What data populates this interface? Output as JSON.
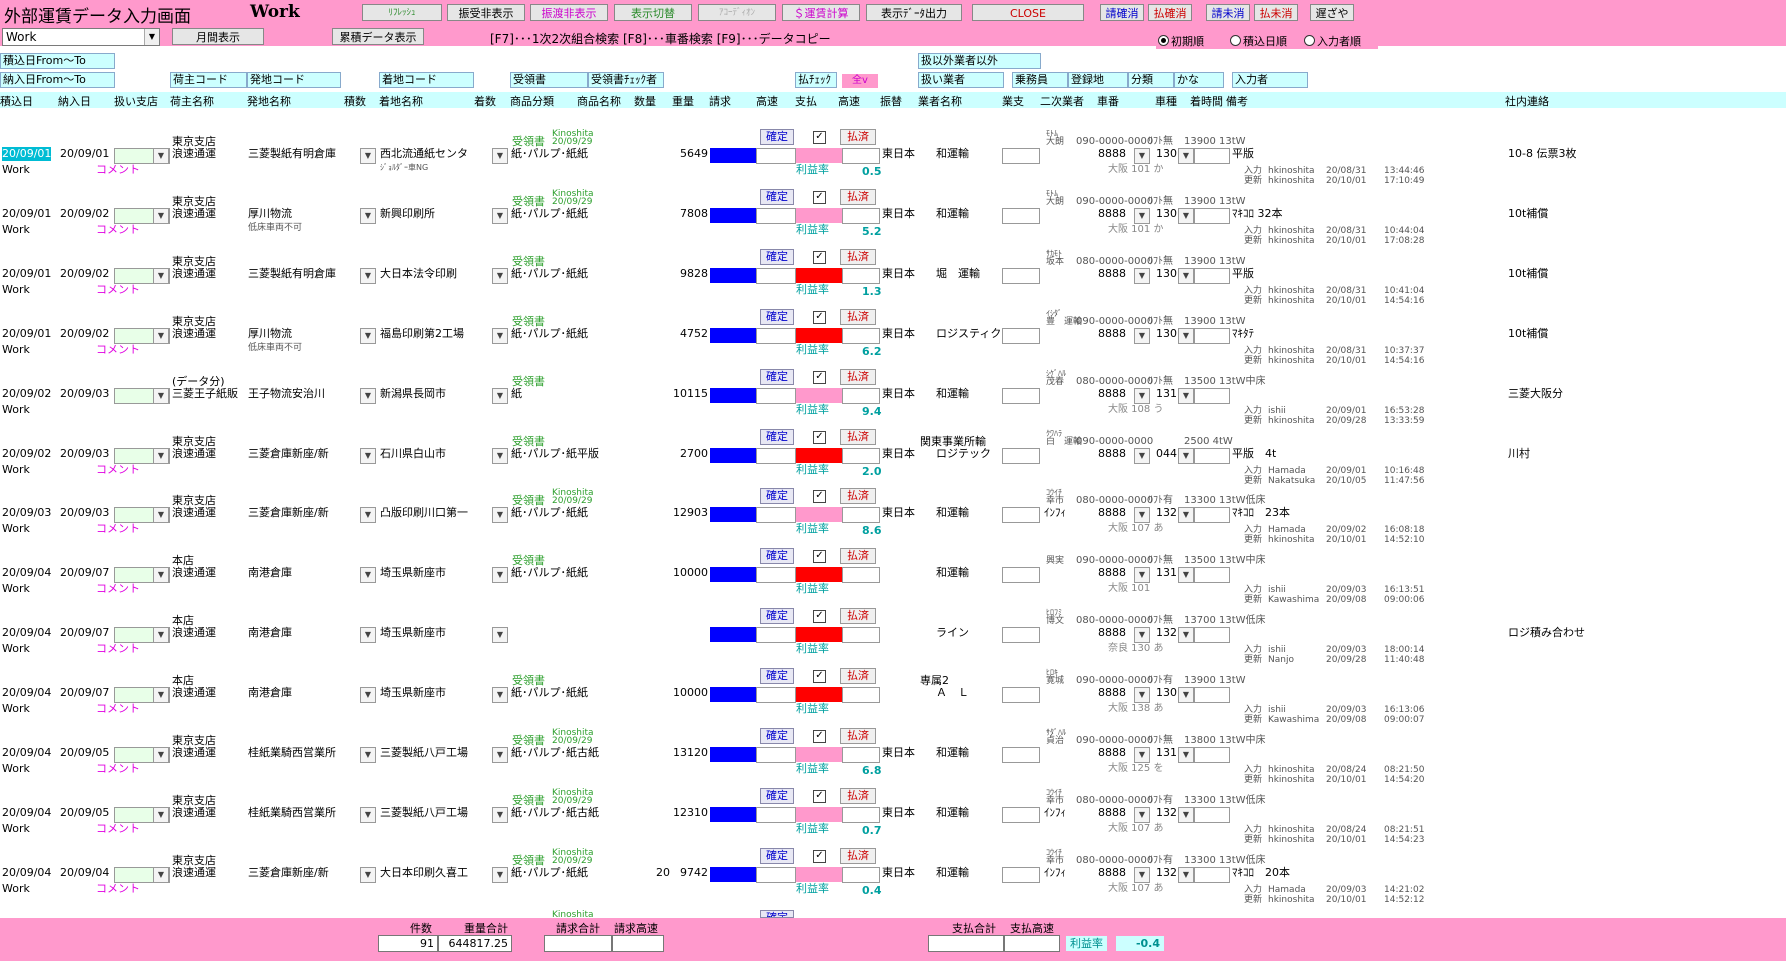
{
  "header": {
    "title": "外部運賃データ入力画面",
    "mode": "Work",
    "buttons": {
      "refresh": "ﾘﾌﾚｯｼｭ",
      "recv_hide": "振受非表示",
      "deliv_hide": "振渡非表示",
      "toggle": "表示切替",
      "accord": "ｱｺｰﾃﾞｨｵﾝ",
      "calc": "＄運賃計算",
      "export": "表示ﾃﾞｰﾀ出力",
      "close": "CLOSE",
      "confirm_clear": "請確消",
      "pay_confirm": "払確消",
      "bill_clear": "請未消",
      "pay_clear": "払未消",
      "delay": "遅ざや"
    },
    "mode_select": "Work",
    "monthly": "月間表示",
    "cumulative": "累積データ表示",
    "fkeys": "[F7]･･･1次2次組合検索  [F8]･･･車番検索  [F9]･･･データコピー",
    "sort": {
      "initial": "初期順",
      "load_date": "積込日順",
      "input_user": "入力者順"
    }
  },
  "filters": {
    "load_from_to": "積込日From〜To",
    "deliv_from_to": "納入日From〜To",
    "other_vendor": "扱以外業者以外",
    "shipper_code": "荷主コード",
    "origin_code": "発地コード",
    "dest_code": "着地コード",
    "receipt": "受領書",
    "receipt_check": "受領書ﾁｪｯｸ者",
    "pay_check": "払ﾁｪｯｸ",
    "all_v": "全v",
    "handler": "扱い業者",
    "crew": "乗務員",
    "reg_place": "登録地",
    "class": "分類",
    "kana": "かな",
    "input_user": "入力者"
  },
  "columns": [
    "積込日",
    "納入日",
    "扱い支店",
    "荷主名称",
    "発地名称",
    "積数",
    "着地名称",
    "着数",
    "商品分類",
    "商品名称",
    "数量",
    "重量",
    "請求",
    "高速",
    "支払",
    "高速",
    "振替",
    "業者名称",
    "業支",
    "二次業者",
    "車番",
    "車種",
    "着時間",
    "備考",
    "社内連絡"
  ],
  "rows": [
    {
      "branch_top": "東京支店",
      "load": "20/09/01",
      "deliv": "20/09/01",
      "shipper": "浪速通運",
      "origin": "三菱製紙有明倉庫",
      "dest": "西北流通紙センタ",
      "dest_note": "ｼﾞｮﾙﾀﾞｰ車NG",
      "receipt": "受領書",
      "kino": "Kinoshita",
      "kdate": "20/09/29",
      "category": "紙･パルプ･紙紙",
      "qty": "",
      "weight": "5649",
      "pay_color": "pink",
      "rate": "0.5",
      "org": "東日本",
      "vendor": "和運輸",
      "sub_kana": "ﾓﾄﾑ",
      "sub": "大朗",
      "phone": "090-0000-0000",
      "lift": "ﾘﾌﾄ無",
      "car": "8888",
      "cartype": "130",
      "place": "大阪 101 か",
      "note_top": "13900 13tW",
      "note": "平版",
      "in_user": "hkinoshita",
      "in_date": "20/08/31",
      "in_time": "13:44:46",
      "up_user": "hkinoshita",
      "up_date": "20/10/01",
      "up_time": "17:10:49",
      "memo": "10-8 伝票3枚",
      "work": "Work",
      "comment": "コメント"
    },
    {
      "branch_top": "東京支店",
      "load": "20/09/01",
      "deliv": "20/09/02",
      "shipper": "浪速通運",
      "origin": "厚川物流",
      "origin_note": "低床車両不可",
      "dest": "新興印刷所",
      "dest_note": "",
      "receipt": "受領書",
      "kino": "Kinoshita",
      "kdate": "20/09/29",
      "category": "紙･パルプ･紙紙",
      "qty": "",
      "weight": "7808",
      "pay_color": "pink",
      "rate": "5.2",
      "org": "東日本",
      "vendor": "和運輸",
      "sub_kana": "ﾓﾄﾑ",
      "sub": "大朗",
      "phone": "090-0000-0000",
      "lift": "ﾘﾌﾄ無",
      "car": "8888",
      "cartype": "130",
      "place": "大阪 101 か",
      "note_top": "13900 13tW",
      "note": "ﾏｷｺﾛ 32本",
      "in_user": "hkinoshita",
      "in_date": "20/08/31",
      "in_time": "10:44:04",
      "up_user": "hkinoshita",
      "up_date": "20/10/01",
      "up_time": "17:08:28",
      "memo": "10t補償",
      "work": "Work",
      "comment": "コメント"
    },
    {
      "branch_top": "東京支店",
      "load": "20/09/01",
      "deliv": "20/09/02",
      "shipper": "浪速通運",
      "origin": "三菱製紙有明倉庫",
      "dest": "大日本法令印刷",
      "dest_note": "",
      "receipt": "受領書",
      "kino": "",
      "kdate": "",
      "category": "紙･パルプ･紙紙",
      "qty": "",
      "weight": "9828",
      "pay_color": "red",
      "rate": "1.3",
      "org": "東日本",
      "vendor": "堀　運輸",
      "sub_kana": "ｻｶﾓﾄ",
      "sub": "坂本",
      "phone": "080-0000-0000",
      "lift": "ﾘﾌﾄ無",
      "car": "8888",
      "cartype": "130",
      "place": "",
      "note_top": "13900 13tW",
      "note": "平版",
      "in_user": "hkinoshita",
      "in_date": "20/08/31",
      "in_time": "10:41:04",
      "up_user": "hkinoshita",
      "up_date": "20/10/01",
      "up_time": "14:54:16",
      "memo": "10t補償",
      "work": "Work",
      "comment": "コメント"
    },
    {
      "branch_top": "東京支店",
      "load": "20/09/01",
      "deliv": "20/09/02",
      "shipper": "浪速通運",
      "origin": "厚川物流",
      "origin_note": "低床車両不可",
      "dest": "福島印刷第2工場",
      "dest_note": "",
      "receipt": "受領書",
      "kino": "",
      "kdate": "",
      "category": "紙･パルプ･紙紙",
      "qty": "",
      "weight": "4752",
      "pay_color": "red",
      "rate": "6.2",
      "org": "東日本",
      "vendor": "ロジスティクス",
      "sub_kana": "ｲｼﾀﾞ",
      "sub": "豊　運輸",
      "phone": "090-0000-0000",
      "lift": "ﾘﾌﾄ無",
      "car": "8888",
      "cartype": "130",
      "place": "",
      "note_top": "13900 13tW",
      "note": "ﾏｷﾀﾃ",
      "in_user": "hkinoshita",
      "in_date": "20/08/31",
      "in_time": "10:37:37",
      "up_user": "hkinoshita",
      "up_date": "20/10/01",
      "up_time": "14:54:16",
      "memo": "10t補償",
      "work": "Work",
      "comment": "コメント"
    },
    {
      "branch_top": "(データ分)",
      "load": "20/09/02",
      "deliv": "20/09/03",
      "shipper": "三菱王子紙販",
      "origin": "王子物流安治川",
      "dest": "新潟県長岡市",
      "dest_note": "",
      "receipt": "受領書",
      "kino": "",
      "kdate": "",
      "category": "紙",
      "qty": "",
      "weight": "10115",
      "pay_color": "pink",
      "rate": "9.4",
      "org": "東日本",
      "vendor": "和運輸",
      "sub_kana": "ｼｹﾞﾊﾙ",
      "sub": "茂春",
      "phone": "080-0000-0000",
      "lift": "ﾘﾌﾄ無",
      "car": "8888",
      "cartype": "131",
      "place": "大阪 108 う",
      "note_top": "13500 13tW中床",
      "note": "",
      "in_user": "ishii",
      "in_date": "20/09/01",
      "in_time": "16:53:28",
      "up_user": "hkinoshita",
      "up_date": "20/09/28",
      "up_time": "13:33:59",
      "memo": "三菱大阪分",
      "work": "Work",
      "comment": ""
    },
    {
      "branch_top": "東京支店",
      "load": "20/09/02",
      "deliv": "20/09/03",
      "shipper": "浪速通運",
      "origin": "三菱倉庫新座/新",
      "dest": "石川県白山市",
      "dest_note": "",
      "receipt": "受領書",
      "kino": "",
      "kdate": "",
      "category": "紙･パルプ･紙平版",
      "qty": "",
      "weight": "2700",
      "pay_color": "red",
      "rate": "2.0",
      "org": "東日本",
      "vendor": "ロジテック",
      "vendor_top": "関東事業所輸",
      "sub_kana": "ｸﾜﾊﾗ",
      "sub": "白　運輸",
      "phone": "090-0000-0000",
      "lift": "",
      "car": "8888",
      "cartype": "044",
      "place": "",
      "note_top": "2500 4tW",
      "note": "平版　4t",
      "in_user": "Hamada",
      "in_date": "20/09/01",
      "in_time": "10:16:48",
      "up_user": "Nakatsuka",
      "up_date": "20/10/05",
      "up_time": "11:47:56",
      "memo": "川村",
      "work": "Work",
      "comment": "コメント"
    },
    {
      "branch_top": "東京支店",
      "load": "20/09/03",
      "deliv": "20/09/03",
      "shipper": "浪速通運",
      "origin": "三菱倉庫新座/新",
      "dest": "凸版印刷川口第一",
      "dest_note": "",
      "receipt": "受領書",
      "kino": "Kinoshita",
      "kdate": "20/09/29",
      "category": "紙･パルプ･紙紙",
      "qty": "",
      "weight": "12903",
      "pay_color": "pink",
      "rate": "8.6",
      "org": "東日本",
      "vendor": "和運輸",
      "sub_kana": "ｺｳｲﾁ",
      "sub": "幸市",
      "phone": "080-0000-0000",
      "lift": "ﾘﾌﾄ有",
      "sub2": "ｲﾝﾌｨ",
      "car": "8888",
      "cartype": "132",
      "place": "大阪 107 あ",
      "note_top": "13300 13tW低床",
      "note": "ﾏｷｺﾛ　23本",
      "in_user": "Hamada",
      "in_date": "20/09/02",
      "in_time": "16:08:18",
      "up_user": "hkinoshita",
      "up_date": "20/10/01",
      "up_time": "14:52:10",
      "memo": "",
      "work": "Work",
      "comment": "コメント"
    },
    {
      "branch_top": "本店",
      "load": "20/09/04",
      "deliv": "20/09/07",
      "shipper": "浪速通運",
      "origin": "南港倉庫",
      "dest": "埼玉県新座市",
      "dest_note": "",
      "receipt": "受領書",
      "kino": "",
      "kdate": "",
      "category": "紙･パルプ･紙紙",
      "qty": "",
      "weight": "10000",
      "pay_color": "red",
      "rate": "",
      "org": "",
      "vendor": "和運輸",
      "sub_kana": "",
      "sub": "興実",
      "phone": "090-0000-0000",
      "lift": "ﾘﾌﾄ無",
      "car": "8888",
      "cartype": "131",
      "place": "大阪 101",
      "note_top": "13500 13tW中床",
      "note": "",
      "in_user": "ishii",
      "in_date": "20/09/03",
      "in_time": "16:13:51",
      "up_user": "Kawashima",
      "up_date": "20/09/08",
      "up_time": "09:00:06",
      "memo": "",
      "work": "Work",
      "comment": "コメント"
    },
    {
      "branch_top": "本店",
      "load": "20/09/04",
      "deliv": "20/09/07",
      "shipper": "浪速通運",
      "origin": "南港倉庫",
      "dest": "埼玉県新座市",
      "dest_note": "",
      "receipt": "",
      "kino": "",
      "kdate": "",
      "category": "",
      "qty": "",
      "weight": "",
      "pay_color": "red",
      "rate": "",
      "org": "",
      "vendor": "ライン",
      "sub_kana": "ﾋﾛﾌﾐ",
      "sub": "博文",
      "phone": "080-0000-0000",
      "lift": "ﾘﾌﾄ無",
      "car": "8888",
      "cartype": "132",
      "place": "奈良 130 あ",
      "note_top": "13700 13tW低床",
      "note": "",
      "in_user": "ishii",
      "in_date": "20/09/03",
      "in_time": "18:00:14",
      "up_user": "Nanjo",
      "up_date": "20/09/28",
      "up_time": "11:40:48",
      "memo": "ロジ積み合わせ",
      "work": "Work",
      "comment": "コメント"
    },
    {
      "branch_top": "本店",
      "load": "20/09/04",
      "deliv": "20/09/07",
      "shipper": "浪速通運",
      "origin": "南港倉庫",
      "dest": "埼玉県新座市",
      "dest_note": "",
      "receipt": "受領書",
      "kino": "",
      "kdate": "",
      "category": "紙･パルプ･紙紙",
      "qty": "",
      "weight": "10000",
      "pay_color": "red",
      "rate": "",
      "org": "",
      "vendor": "Ａ　Ｌ",
      "vendor_top": "専属2",
      "sub_kana": "ﾋﾛｷ",
      "sub": "寛城",
      "phone": "090-0000-0000",
      "lift": "ﾘﾌﾄ有",
      "car": "8888",
      "cartype": "130",
      "place": "大阪 138 あ",
      "note_top": "13900 13tW",
      "note": "",
      "in_user": "ishii",
      "in_date": "20/09/03",
      "in_time": "16:13:06",
      "up_user": "Kawashima",
      "up_date": "20/09/08",
      "up_time": "09:00:07",
      "memo": "",
      "work": "Work",
      "comment": "コメント"
    },
    {
      "branch_top": "東京支店",
      "load": "20/09/04",
      "deliv": "20/09/05",
      "shipper": "浪速通運",
      "origin": "桂紙業騎西営業所",
      "dest": "三菱製紙八戸工場",
      "dest_note": "",
      "receipt": "受領書",
      "kino": "Kinoshita",
      "kdate": "20/09/29",
      "category": "紙･パルプ･紙古紙",
      "qty": "",
      "weight": "13120",
      "pay_color": "pink",
      "rate": "6.8",
      "org": "東日本",
      "vendor": "和運輸",
      "sub_kana": "ｻﾀﾞﾊﾙ",
      "sub": "貞治",
      "phone": "090-0000-0000",
      "lift": "ﾘﾌﾄ無",
      "car": "8888",
      "cartype": "131",
      "place": "大阪 125 を",
      "note_top": "13800 13tW中床",
      "note": "",
      "in_user": "hkinoshita",
      "in_date": "20/08/24",
      "in_time": "08:21:50",
      "up_user": "hkinoshita",
      "up_date": "20/10/01",
      "up_time": "14:54:20",
      "memo": "",
      "work": "Work",
      "comment": "コメント"
    },
    {
      "branch_top": "東京支店",
      "load": "20/09/04",
      "deliv": "20/09/05",
      "shipper": "浪速通運",
      "origin": "桂紙業騎西営業所",
      "dest": "三菱製紙八戸工場",
      "dest_note": "",
      "receipt": "受領書",
      "kino": "Kinoshita",
      "kdate": "20/09/29",
      "category": "紙･パルプ･紙古紙",
      "qty": "",
      "weight": "12310",
      "pay_color": "pink",
      "rate": "0.7",
      "org": "東日本",
      "vendor": "和運輸",
      "sub_kana": "ｺｳｲﾁ",
      "sub": "幸市",
      "phone": "080-0000-0000",
      "lift": "ﾘﾌﾄ有",
      "sub2": "ｲﾝﾌｨ",
      "car": "8888",
      "cartype": "132",
      "place": "大阪 107 あ",
      "note_top": "13300 13tW低床",
      "note": "",
      "in_user": "hkinoshita",
      "in_date": "20/08/24",
      "in_time": "08:21:51",
      "up_user": "hkinoshita",
      "up_date": "20/10/01",
      "up_time": "14:54:23",
      "memo": "",
      "work": "Work",
      "comment": "コメント"
    },
    {
      "branch_top": "東京支店",
      "load": "20/09/04",
      "deliv": "20/09/04",
      "shipper": "浪速通運",
      "origin": "三菱倉庫新座/新",
      "dest": "大日本印刷久喜工",
      "dest_note": "",
      "receipt": "受領書",
      "kino": "Kinoshita",
      "kdate": "20/09/29",
      "category": "紙･パルプ･紙紙",
      "qty": "20",
      "weight": "9742",
      "pay_color": "pink",
      "rate": "0.4",
      "org": "東日本",
      "vendor": "和運輸",
      "sub_kana": "ｺｳｲﾁ",
      "sub": "幸市",
      "phone": "080-0000-0000",
      "lift": "ﾘﾌﾄ有",
      "sub2": "ｲﾝﾌｨ",
      "car": "8888",
      "cartype": "132",
      "place": "大阪 107 あ",
      "note_top": "13300 13tW低床",
      "note": "ﾏｷｺﾛ　20本",
      "in_user": "Hamada",
      "in_date": "20/09/03",
      "in_time": "14:21:02",
      "up_user": "hkinoshita",
      "up_date": "20/10/01",
      "up_time": "14:52:12",
      "memo": "",
      "work": "Work",
      "comment": "コメント"
    }
  ],
  "labels": {
    "confirm": "確定",
    "paid": "払済",
    "profit_rate": "利益率",
    "in": "入力",
    "up": "更新"
  },
  "footer": {
    "count_label": "件数",
    "count": "91",
    "weight_label": "重量合計",
    "weight": "644817.25",
    "bill_label": "請求合計",
    "bill_hw_label": "請求高速",
    "pay_label": "支払合計",
    "pay_hw_label": "支払高速",
    "rate_label": "利益率",
    "rate": "-0.4",
    "kino_partial": "Kinoshita",
    "confirm_partial": "確定"
  },
  "colors": {
    "pink": "#ff99cc",
    "cyan": "#ccffff",
    "blue": "#0000ff",
    "red": "#ff0000",
    "rowpink": "#ff99cc"
  }
}
